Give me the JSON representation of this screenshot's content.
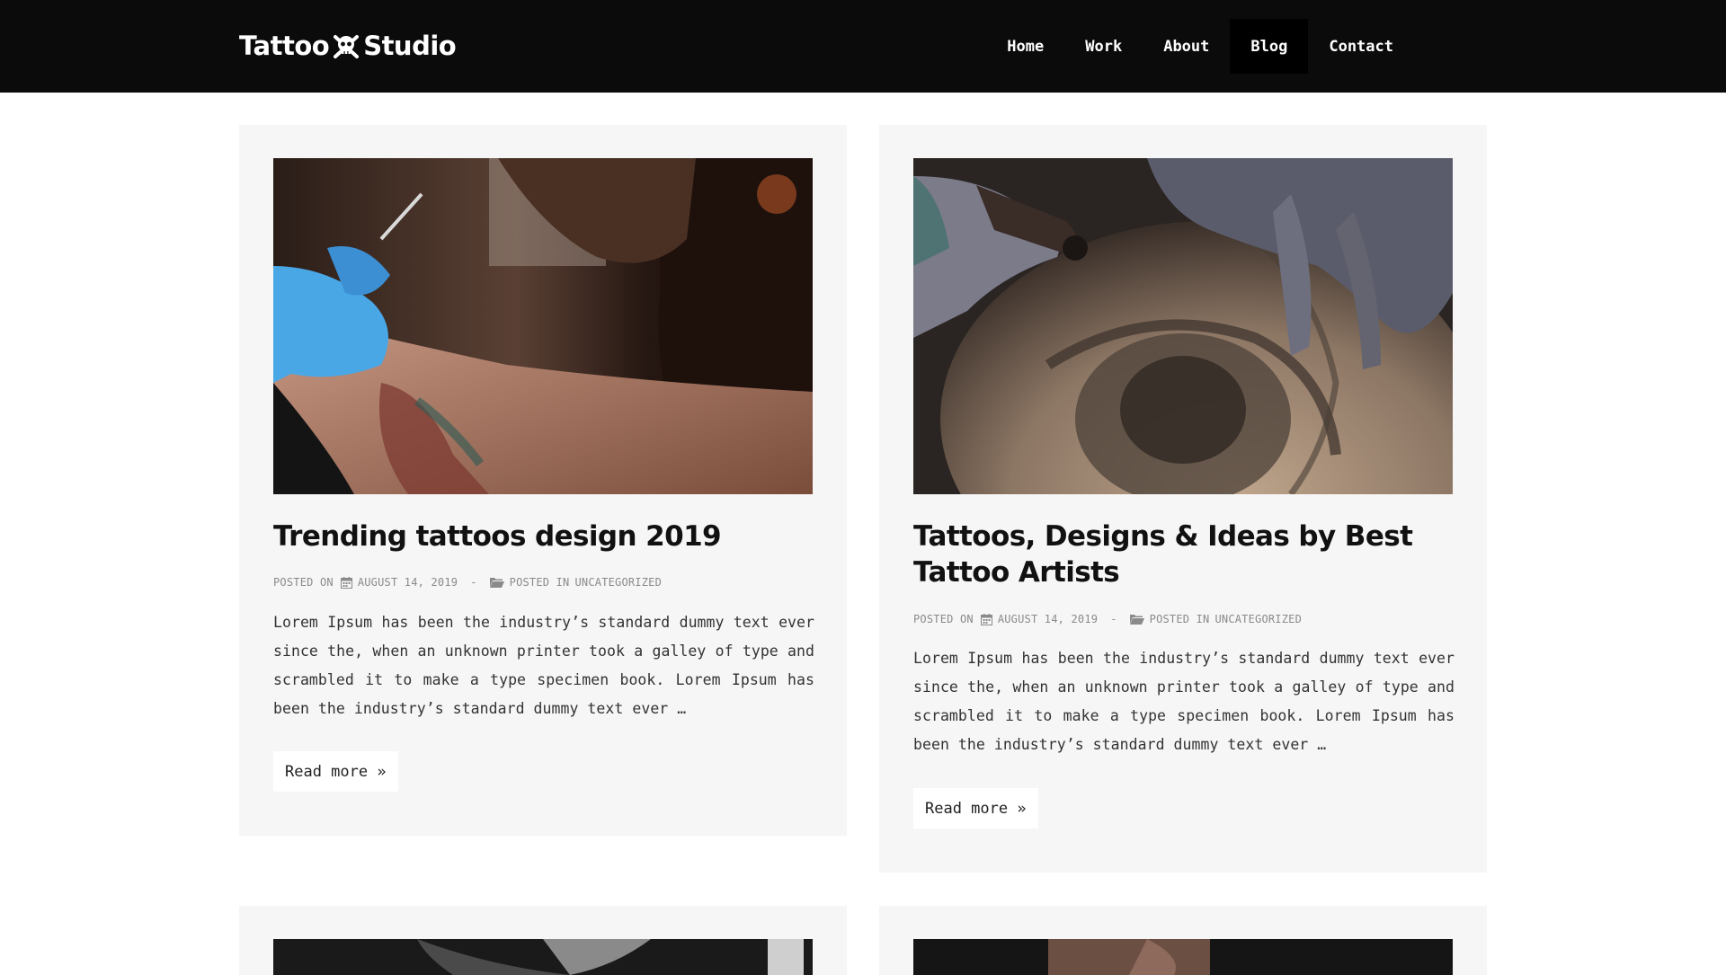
{
  "site": {
    "logo_left": "Tattoo",
    "logo_right": "Studio"
  },
  "nav": {
    "items": [
      {
        "label": "Home"
      },
      {
        "label": "Work"
      },
      {
        "label": "About"
      },
      {
        "label": "Blog"
      },
      {
        "label": "Contact"
      }
    ],
    "active": "Blog"
  },
  "posts": [
    {
      "title": "Trending tattoos design 2019",
      "posted_on_label": "POSTED ON",
      "date": "AUGUST 14, 2019",
      "separator": "-",
      "posted_in_label": "POSTED IN",
      "category": "UNCATEGORIZED",
      "excerpt": "Lorem Ipsum has been the industry’s standard dummy text ever since the, when an unknown printer took a galley of type and scrambled it to make a type specimen book. Lorem Ipsum has been the industry’s standard dummy text ever …",
      "read_more": "Read more »"
    },
    {
      "title": "Tattoos, Designs & Ideas by Best Tattoo Artists",
      "posted_on_label": "POSTED ON",
      "date": "AUGUST 14, 2019",
      "separator": "-",
      "posted_in_label": "POSTED IN",
      "category": "UNCATEGORIZED",
      "excerpt": "Lorem Ipsum has been the industry’s standard dummy text ever since the, when an unknown printer took a galley of type and scrambled it to make a type specimen book. Lorem Ipsum has been the industry’s standard dummy text ever …",
      "read_more": "Read more »"
    }
  ],
  "colors": {
    "header_bg": "#0b0b0b",
    "card_bg": "#f6f6f6",
    "meta_text": "#8a8a8a"
  }
}
